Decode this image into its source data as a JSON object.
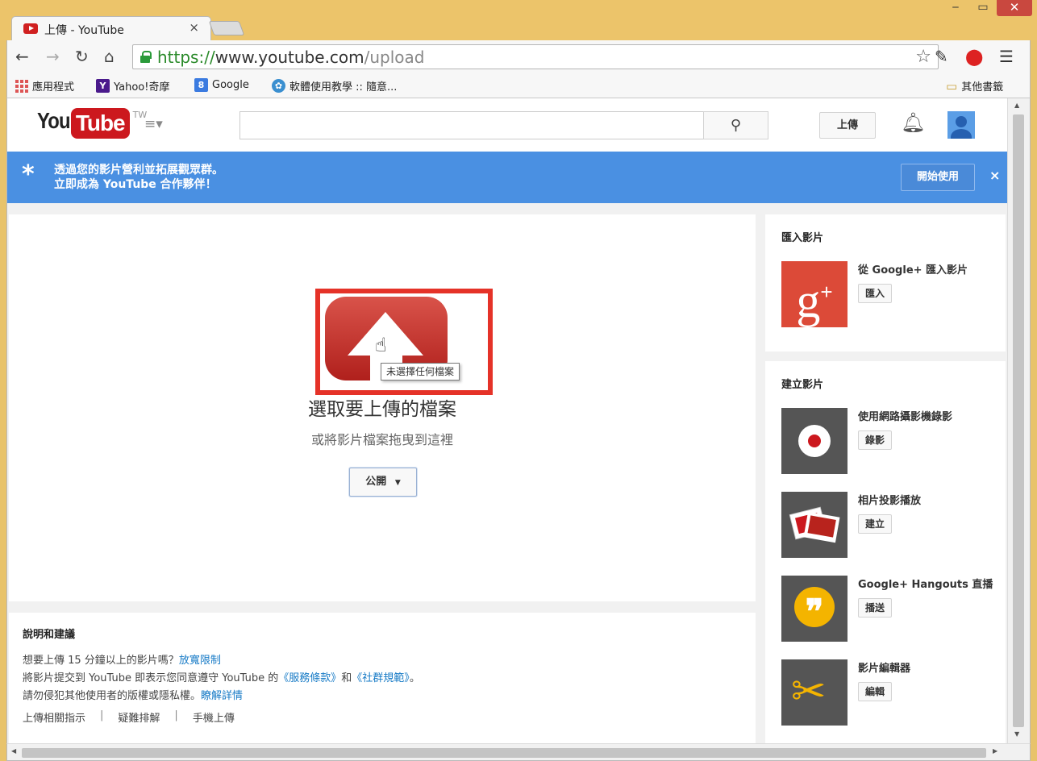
{
  "browser": {
    "tab_title": "上傳 - YouTube",
    "tab_close": "×",
    "url_scheme": "https://",
    "url_host": "www.youtube.com",
    "url_path": "/upload",
    "window_controls": [
      "‒",
      "▭",
      "✕"
    ],
    "bookmarks": [
      {
        "label": "應用程式",
        "icon": "apps-grid-icon"
      },
      {
        "label": "Yahoo!奇摩",
        "icon": "yahoo-icon"
      },
      {
        "label": "Google",
        "icon": "google-icon"
      },
      {
        "label": "軟體使用教學 :: 隨意...",
        "icon": "blog-icon"
      }
    ],
    "other_bookmarks": "其他書籤"
  },
  "header": {
    "logo_you": "You",
    "logo_tube": "Tube",
    "logo_region": "TW",
    "search_placeholder": "",
    "upload_label": "上傳"
  },
  "promo": {
    "line1": "透過您的影片營利並拓展觀眾群。",
    "line2": "立即成為 YouTube 合作夥伴！",
    "button": "開始使用",
    "close": "×"
  },
  "upload": {
    "tooltip": "未選擇任何檔案",
    "title": "選取要上傳的檔案",
    "subtitle": "或將影片檔案拖曳到這裡",
    "privacy": "公開"
  },
  "help": {
    "title": "說明和建議",
    "line1_text": "想要上傳 15 分鐘以上的影片嗎？",
    "line1_link": "放寬限制",
    "line2_a": "將影片提交到 YouTube 即表示您同意遵守 YouTube 的",
    "line2_link1": "《服務條款》",
    "line2_b": "和",
    "line2_link2": "《社群規範》",
    "line2_c": "。",
    "line3_text": "請勿侵犯其他使用者的版權或隱私權。",
    "line3_link": "瞭解詳情",
    "links": [
      "上傳相關指示",
      "疑難排解",
      "手機上傳"
    ]
  },
  "import_panel": {
    "title": "匯入影片",
    "item_label": "從 Google+ 匯入影片",
    "item_button": "匯入"
  },
  "create_panel": {
    "title": "建立影片",
    "items": [
      {
        "label": "使用網路攝影機錄影",
        "button": "錄影",
        "icon": "record-icon"
      },
      {
        "label": "相片投影播放",
        "button": "建立",
        "icon": "photo-slideshow-icon"
      },
      {
        "label": "Google+ Hangouts 直播",
        "button": "播送",
        "icon": "hangouts-icon"
      },
      {
        "label": "影片編輯器",
        "button": "編輯",
        "icon": "scissors-icon"
      }
    ]
  },
  "colors": {
    "promo_blue": "#4a90e2",
    "youtube_red": "#cc181e",
    "highlight_red": "#e53228",
    "link_blue": "#167ac6"
  }
}
